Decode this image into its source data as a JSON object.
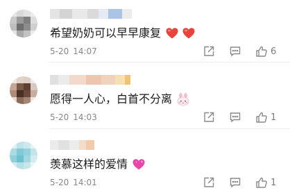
{
  "colors": {
    "heart_red": "#e8433c",
    "heart_pink": "#e846a8",
    "meta_gray": "#888888",
    "text": "#1a1a1a"
  },
  "comments": [
    {
      "text": "希望奶奶可以早早康复",
      "emojis": [
        "red-heart-icon",
        "red-heart-icon"
      ],
      "date": "5-20",
      "time": "14:07",
      "likes": "6"
    },
    {
      "text": "愿得一人心，白首不分离",
      "emojis": [
        "bunny-face-icon"
      ],
      "date": "5-20",
      "time": "14:03",
      "likes": "1"
    },
    {
      "text": "羡慕这样的爱情",
      "emojis": [
        "sparkling-heart-icon"
      ],
      "date": "5-20",
      "time": "14:01",
      "likes": "1"
    }
  ]
}
